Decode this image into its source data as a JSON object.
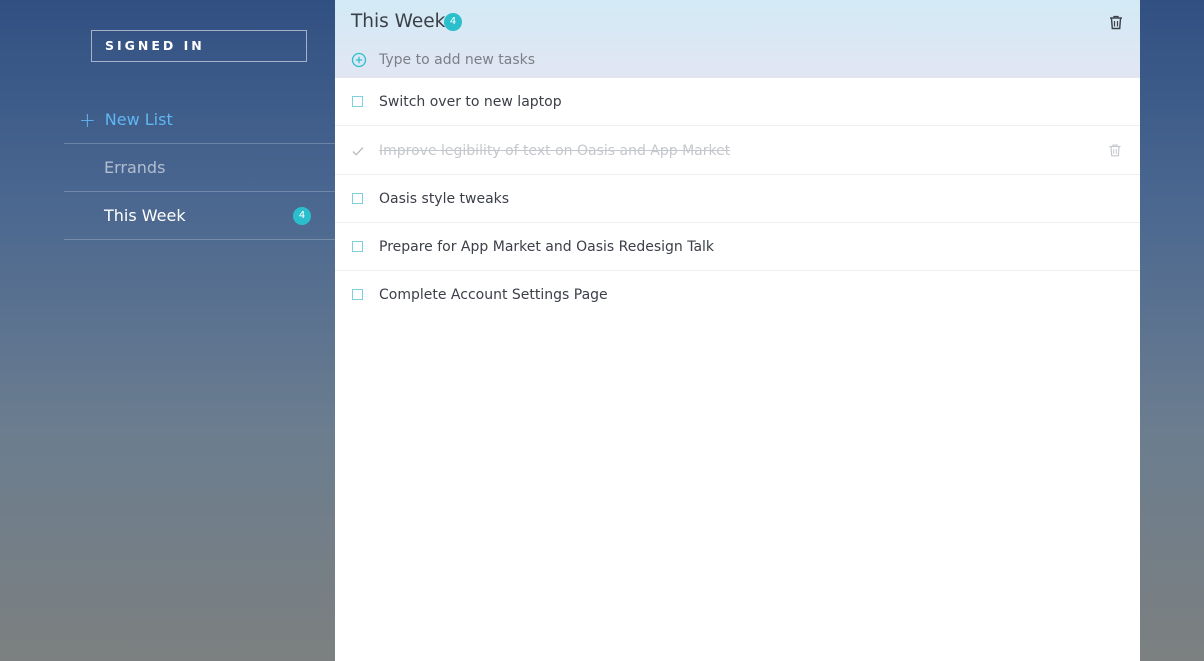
{
  "sidebar": {
    "signed_in_label": "SIGNED IN",
    "new_list_label": "New List",
    "lists": [
      {
        "label": "Errands",
        "count": null
      },
      {
        "label": "This Week",
        "count": "4"
      }
    ]
  },
  "main": {
    "title": "This Week",
    "count": "4",
    "add_placeholder": "Type to add new tasks",
    "tasks": [
      {
        "text": "Switch over to new laptop",
        "done": false
      },
      {
        "text": "Improve legibility of text on Oasis and App Market",
        "done": true
      },
      {
        "text": "Oasis style tweaks",
        "done": false
      },
      {
        "text": "Prepare for App Market and Oasis Redesign Talk",
        "done": false
      },
      {
        "text": "Complete Account Settings Page",
        "done": false
      }
    ]
  },
  "colors": {
    "accent": "#2bbfce",
    "link": "#5fb6f2",
    "checkbox_border": "#7ecfe0"
  }
}
